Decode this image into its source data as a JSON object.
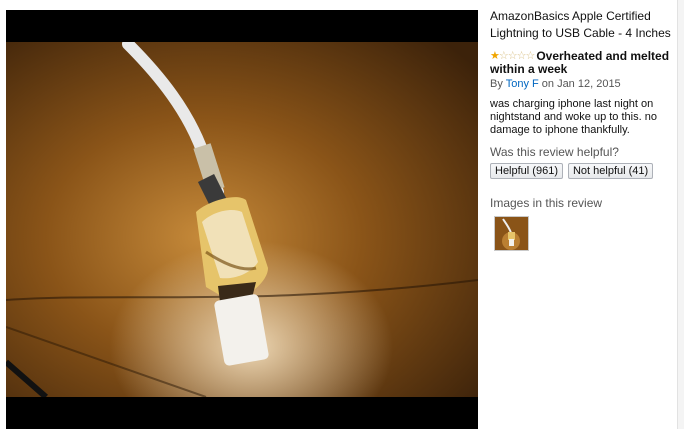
{
  "product": {
    "title": "AmazonBasics Apple Certified Lightning to USB Cable - 4 Inches"
  },
  "review": {
    "rating": 1,
    "rating_max": 5,
    "headline": "Overheated and melted within a week",
    "by_prefix": "By ",
    "author": "Tony F",
    "date_text": " on Jan 12, 2015",
    "body": "was charging iphone last night on nightstand and woke up to this. no damage to iphone thankfully."
  },
  "helpful": {
    "question": "Was this review helpful?",
    "yes_label": "Helpful (961)",
    "no_label": "Not helpful (41)"
  },
  "images": {
    "heading": "Images in this review"
  },
  "colors": {
    "star": "#f0a500",
    "link": "#0066c0",
    "viewer_bg": "#000000"
  },
  "icons": {
    "photo": "melted-cable-photo",
    "thumbnail": "melted-cable-thumbnail"
  }
}
